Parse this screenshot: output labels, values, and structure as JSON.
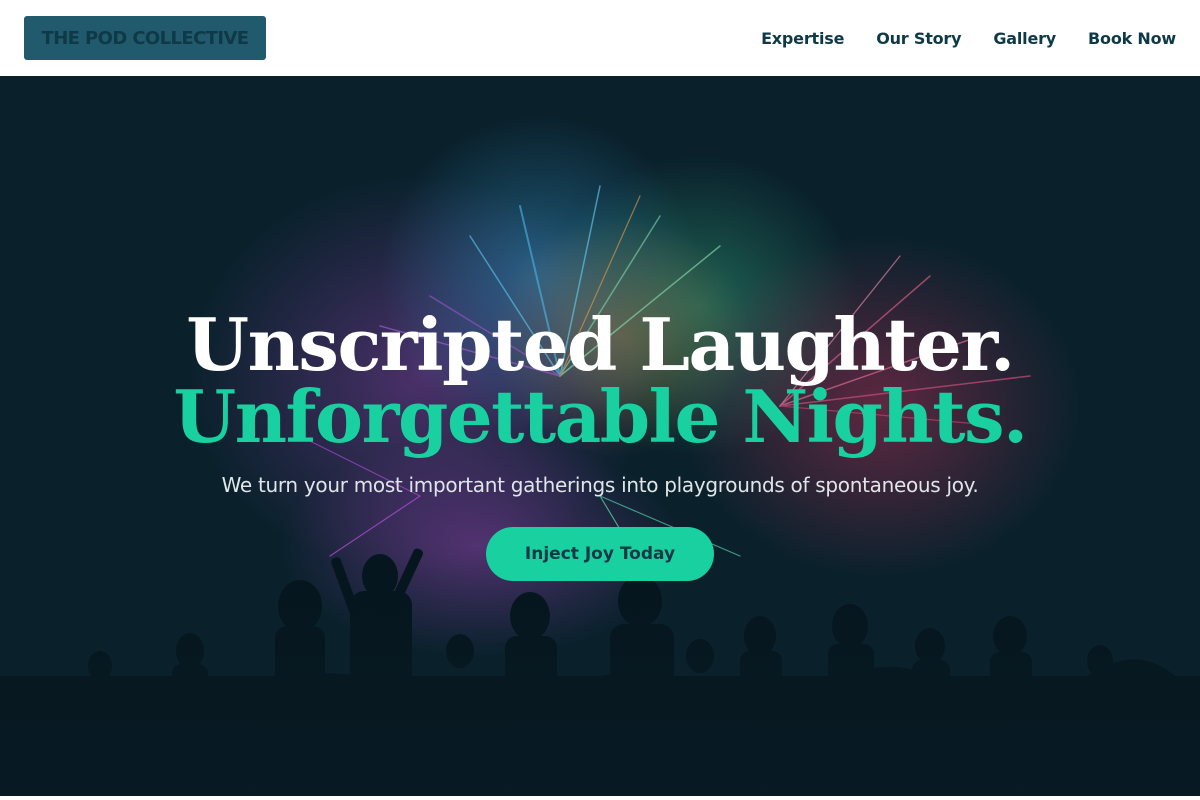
{
  "brand": {
    "logo_text": "THE POD COLLECTIVE"
  },
  "nav": {
    "links": [
      {
        "label": "Expertise"
      },
      {
        "label": "Our Story"
      },
      {
        "label": "Gallery"
      },
      {
        "label": "Book Now"
      }
    ]
  },
  "hero": {
    "headline_line1": "Unscripted Laughter.",
    "headline_line2": "Unforgettable Nights.",
    "subheadline": "We turn your most important gatherings into playgrounds of spontaneous joy.",
    "cta_label": "Inject Joy Today",
    "background_image": "fireworks-crowd-silhouette"
  },
  "colors": {
    "accent": "#19d0a0",
    "nav_text": "#0e3a48",
    "logo_bg": "#215a6c",
    "hero_bg": "#0a212c",
    "white": "#ffffff"
  }
}
